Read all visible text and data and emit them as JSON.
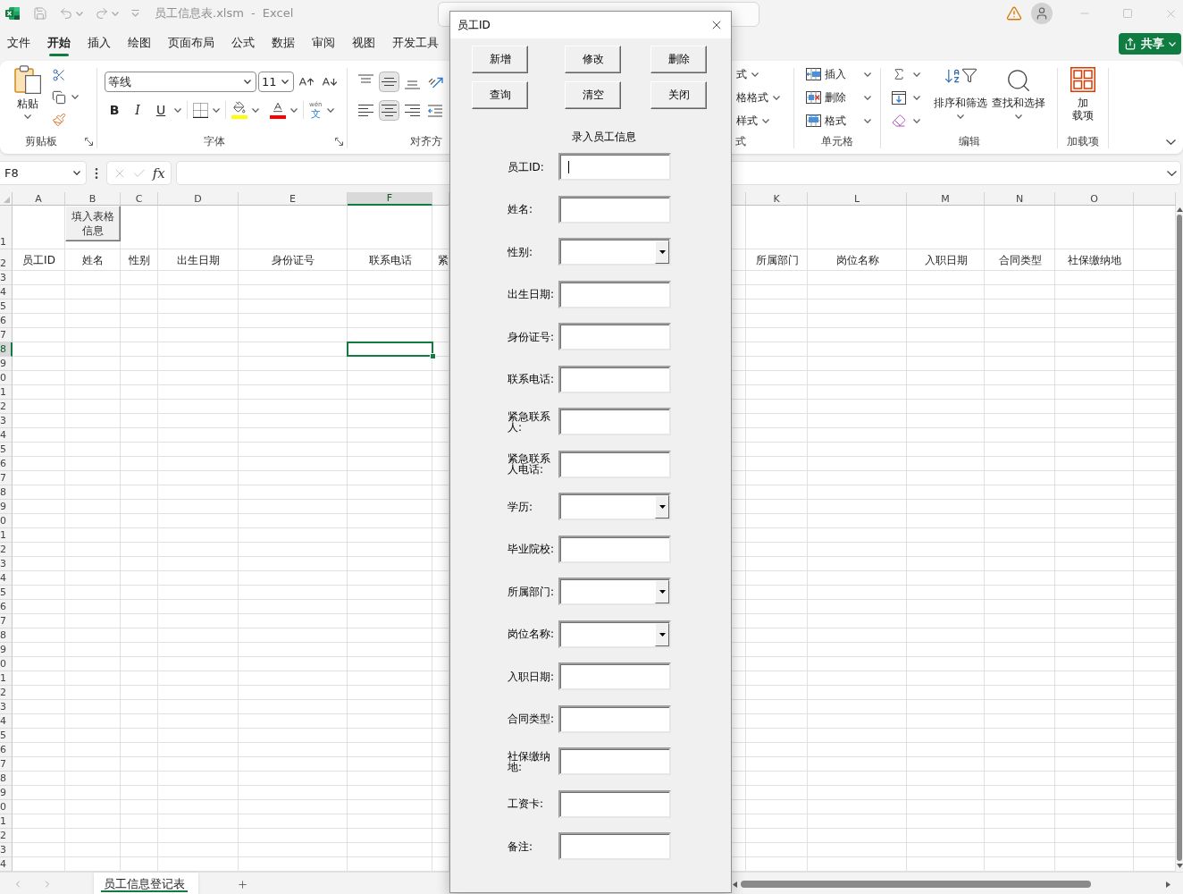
{
  "title_bar": {
    "document_title": "员工信息表.xlsm - Excel"
  },
  "ribbon_tabs": [
    {
      "label": "文件",
      "selected": false
    },
    {
      "label": "开始",
      "selected": true
    },
    {
      "label": "插入",
      "selected": false
    },
    {
      "label": "绘图",
      "selected": false
    },
    {
      "label": "页面布局",
      "selected": false
    },
    {
      "label": "公式",
      "selected": false
    },
    {
      "label": "数据",
      "selected": false
    },
    {
      "label": "审阅",
      "selected": false
    },
    {
      "label": "视图",
      "selected": false
    },
    {
      "label": "开发工具",
      "selected": false
    }
  ],
  "share_button": {
    "label": "共享"
  },
  "ribbon": {
    "clipboard": {
      "paste_label": "粘贴",
      "group_label": "剪贴板"
    },
    "font": {
      "font_name": "等线",
      "font_size": "11",
      "format_buttons": [
        {
          "kind": "bold",
          "label": "B"
        },
        {
          "kind": "italic",
          "label": "I"
        },
        {
          "kind": "underline",
          "label": "U"
        }
      ],
      "phonetic": {
        "pinyin": "wén",
        "hanzi": "文"
      },
      "group_label": "字体"
    },
    "alignment": {
      "vertical": [
        {
          "kind": "top",
          "selected": false
        },
        {
          "kind": "middle",
          "selected": true
        },
        {
          "kind": "bottom",
          "selected": false
        }
      ],
      "horizontal": [
        {
          "kind": "left",
          "selected": false
        },
        {
          "kind": "center",
          "selected": true
        },
        {
          "kind": "right",
          "selected": false
        }
      ],
      "group_label": "对齐方"
    },
    "styles": {
      "items": [
        "式",
        "格格式",
        "样式"
      ],
      "group_label": "式"
    },
    "cells": {
      "items": [
        {
          "kind": "insert",
          "label": "插入"
        },
        {
          "kind": "delete",
          "label": "删除"
        },
        {
          "kind": "format",
          "label": "格式"
        }
      ],
      "group_label": "单元格"
    },
    "editing": {
      "sort_filter": "排序和筛选",
      "find_select": "查找和选择",
      "group_label": "编辑"
    },
    "add_ins": {
      "button_lines": [
        "加",
        "载项"
      ],
      "group_label": "加载项"
    }
  },
  "formula_bar": {
    "name_box": "F8",
    "function_label": "fx"
  },
  "sheet": {
    "columns_left": [
      {
        "letter": "A",
        "selected": false
      },
      {
        "letter": "B",
        "selected": false
      },
      {
        "letter": "C",
        "selected": false
      },
      {
        "letter": "D",
        "selected": false
      },
      {
        "letter": "E",
        "selected": false
      },
      {
        "letter": "F",
        "selected": true
      }
    ],
    "columns_right": [
      {
        "letter": "K",
        "selected": false
      },
      {
        "letter": "L",
        "selected": false
      },
      {
        "letter": "M",
        "selected": false
      },
      {
        "letter": "N",
        "selected": false
      },
      {
        "letter": "O",
        "selected": false
      }
    ],
    "rows": [
      {
        "label": "1",
        "selected": false,
        "button": "填入表格信息"
      },
      {
        "label": "2",
        "selected": false,
        "cells_left": [
          "员工ID",
          "姓名",
          "性别",
          "出生日期",
          "身份证号",
          "联系电话"
        ],
        "partial_cell": "紧",
        "cells_right": [
          "所属部门",
          "岗位名称",
          "入职日期",
          "合同类型",
          "社保缴纳地"
        ]
      },
      {
        "label": "3",
        "selected": false
      },
      {
        "label": "4",
        "selected": false
      },
      {
        "label": "5",
        "selected": false
      },
      {
        "label": "6",
        "selected": false
      },
      {
        "label": "7",
        "selected": false
      },
      {
        "label": "8",
        "selected": true
      },
      {
        "label": "9",
        "selected": false
      },
      {
        "label": "0",
        "selected": false
      },
      {
        "label": "1",
        "selected": false
      },
      {
        "label": "2",
        "selected": false
      },
      {
        "label": "3",
        "selected": false
      },
      {
        "label": "4",
        "selected": false
      },
      {
        "label": "5",
        "selected": false
      },
      {
        "label": "6",
        "selected": false
      },
      {
        "label": "7",
        "selected": false
      },
      {
        "label": "8",
        "selected": false
      },
      {
        "label": "9",
        "selected": false
      },
      {
        "label": "0",
        "selected": false
      },
      {
        "label": "1",
        "selected": false
      },
      {
        "label": "2",
        "selected": false
      },
      {
        "label": "3",
        "selected": false
      },
      {
        "label": "4",
        "selected": false
      },
      {
        "label": "5",
        "selected": false
      },
      {
        "label": "6",
        "selected": false
      },
      {
        "label": "7",
        "selected": false
      },
      {
        "label": "8",
        "selected": false
      },
      {
        "label": "9",
        "selected": false
      },
      {
        "label": "0",
        "selected": false
      },
      {
        "label": "1",
        "selected": false
      },
      {
        "label": "2",
        "selected": false
      },
      {
        "label": "3",
        "selected": false
      },
      {
        "label": "4",
        "selected": false
      },
      {
        "label": "5",
        "selected": false
      },
      {
        "label": "6",
        "selected": false
      },
      {
        "label": "7",
        "selected": false
      },
      {
        "label": "8",
        "selected": false
      },
      {
        "label": "9",
        "selected": false
      },
      {
        "label": "0",
        "selected": false
      },
      {
        "label": "1",
        "selected": false
      },
      {
        "label": "2",
        "selected": false
      },
      {
        "label": "3",
        "selected": false
      },
      {
        "label": "4",
        "selected": false
      }
    ]
  },
  "sheet_tabs": [
    {
      "label": "员工信息登记表",
      "selected": true
    }
  ],
  "dialog": {
    "title": "员工ID",
    "buttons": [
      "新增",
      "修改",
      "删除",
      "查询",
      "清空",
      "关闭"
    ],
    "heading": "录入员工信息",
    "fields": [
      {
        "label": "员工ID:",
        "kind": "text",
        "focused": true
      },
      {
        "label": "姓名:",
        "kind": "text",
        "focused": false
      },
      {
        "label": "性别:",
        "kind": "combo",
        "focused": false
      },
      {
        "label": "出生日期:",
        "kind": "text",
        "focused": false
      },
      {
        "label": "身份证号:",
        "kind": "text",
        "focused": false
      },
      {
        "label": "联系电话:",
        "kind": "text",
        "focused": false
      },
      {
        "label": "紧急联系人:",
        "kind": "text",
        "focused": false
      },
      {
        "label": "紧急联系人电话:",
        "kind": "text",
        "focused": false
      },
      {
        "label": "学历:",
        "kind": "combo",
        "focused": false
      },
      {
        "label": "毕业院校:",
        "kind": "text",
        "focused": false
      },
      {
        "label": "所属部门:",
        "kind": "combo",
        "focused": false
      },
      {
        "label": "岗位名称:",
        "kind": "combo",
        "focused": false
      },
      {
        "label": "入职日期:",
        "kind": "text",
        "focused": false
      },
      {
        "label": "合同类型:",
        "kind": "text",
        "focused": false
      },
      {
        "label": "社保缴纳地:",
        "kind": "text",
        "focused": false
      },
      {
        "label": "工资卡:",
        "kind": "text",
        "focused": false
      },
      {
        "label": "备注:",
        "kind": "text",
        "focused": false
      }
    ]
  }
}
